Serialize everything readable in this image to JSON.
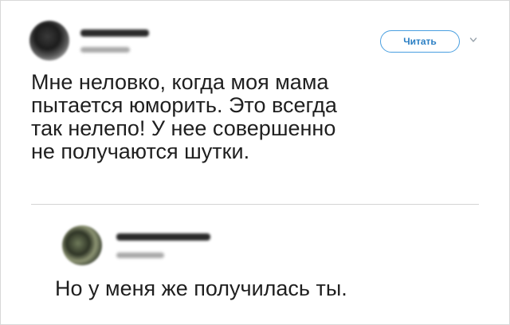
{
  "tweet": {
    "follow_label": "Читать",
    "menu_icon": "chevron-down-icon",
    "text": "Мне неловко, когда моя мама\nпытается юморить. Это всегда\nтак нелепо! У нее совершенно\nне получаются шутки."
  },
  "reply": {
    "text": "Но у меня же получилась ты."
  },
  "colors": {
    "accent": "#2b7fc4",
    "border": "#4a9fe0",
    "text": "#1f1f1f",
    "divider": "#d4d4d4"
  }
}
